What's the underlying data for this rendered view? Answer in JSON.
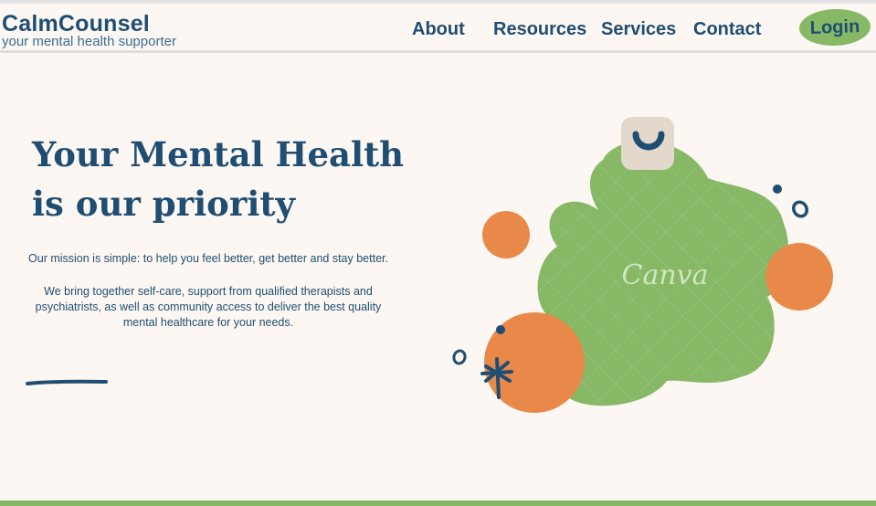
{
  "brand": {
    "name": "CalmCounsel",
    "tagline": "your mental health supporter"
  },
  "nav": {
    "items": [
      {
        "id": "about",
        "label": "About"
      },
      {
        "id": "resources",
        "label": "Resources"
      },
      {
        "id": "services",
        "label": "Services"
      },
      {
        "id": "contact",
        "label": "Contact"
      }
    ],
    "login_label": "Login"
  },
  "hero": {
    "title_line1": "Your Mental Health",
    "title_line2": "is our priority",
    "mission_p1": "Our mission is simple: to help you feel better, get better and stay better.",
    "mission_p2": "We bring together self-care, support from qualified therapists and psychiatrists, as well as community access to deliver the best quality mental healthcare for your needs."
  },
  "illustration": {
    "watermark": "Canva"
  },
  "colors": {
    "primary": "#1f4e72",
    "accent_green": "#86b866",
    "accent_orange": "#e8894a",
    "background": "#fcf7f2",
    "tile_beige": "#e3d8cc"
  }
}
